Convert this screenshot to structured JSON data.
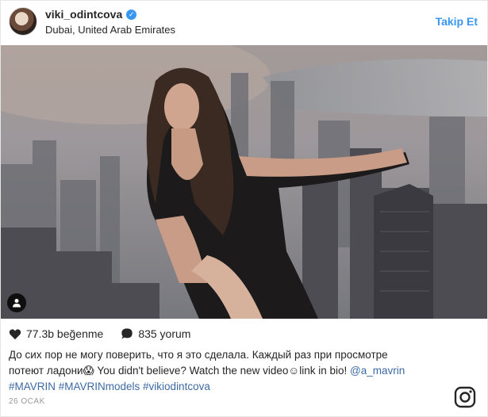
{
  "header": {
    "username": "viki_odintcova",
    "location": "Dubai, United Arab Emirates",
    "follow_label": "Takip Et"
  },
  "actions": {
    "likes": "77.3b beğenme",
    "comments": "835 yorum"
  },
  "caption": {
    "line1": "До сих пор не могу поверить, что я это сделала. Каждый раз при просмотре",
    "line2_start": "потеют ладони",
    "line2_mid": " You didn't believe? Watch the new video",
    "line2_end": "link in bio! ",
    "mention": "@a_mavrin",
    "hashtags": "#MAVRIN #MAVRINmodels #vikiodintcova"
  },
  "date": "26 OCAK",
  "colors": {
    "link": "#3d6aa3",
    "follow": "#3897f0"
  },
  "icons": [
    "verified-badge-icon",
    "heart-icon",
    "comment-icon",
    "user-tag-icon",
    "instagram-logo-icon"
  ]
}
